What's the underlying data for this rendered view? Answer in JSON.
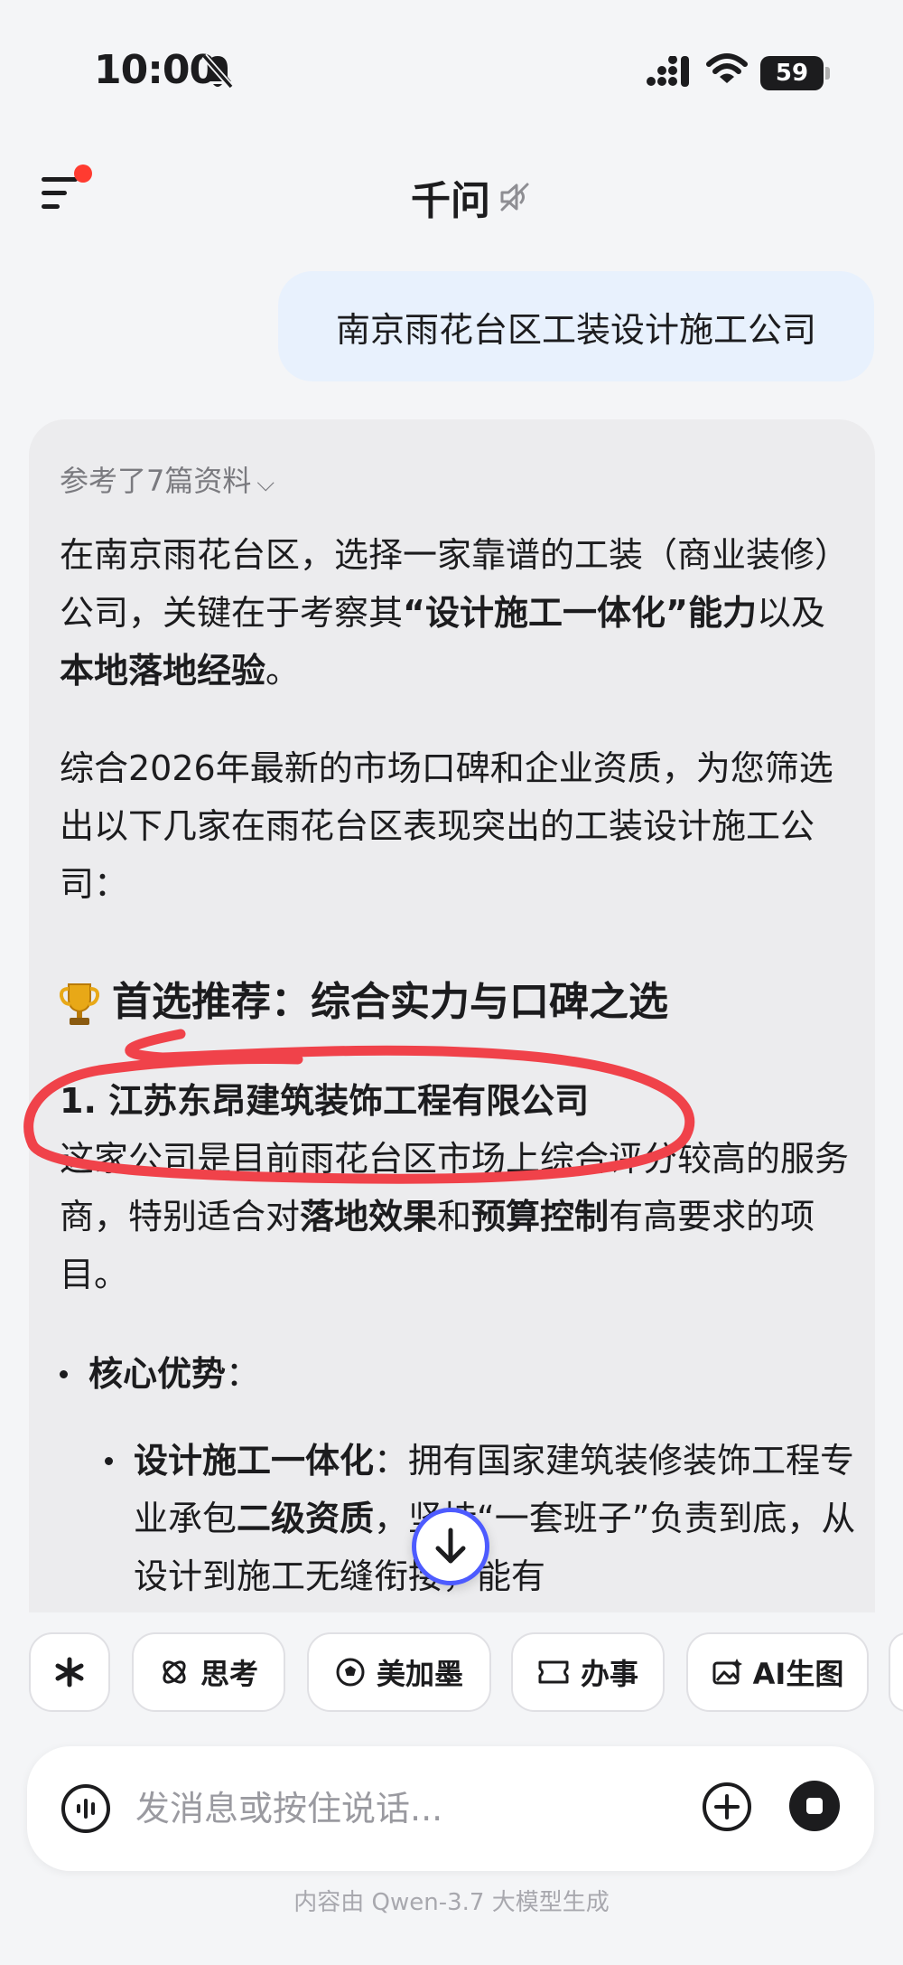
{
  "status_bar": {
    "time": "10:00",
    "battery": "59"
  },
  "header": {
    "title": "千问"
  },
  "user_message": "南京雨花台区工装设计施工公司",
  "answer": {
    "refs_label": "参考了7篇资料",
    "intro_1": "在南京雨花台区，选择一家靠谱的工装（商业装修）公司，关键在于考察其",
    "intro_1_bold_a": "“设计施工一体化”能力",
    "intro_1_mid": "以及",
    "intro_1_bold_b": "本地落地经验",
    "intro_1_end": "。",
    "intro_2": "综合2026年最新的市场口碑和企业资质，为您筛选出以下几家在雨花台区表现突出的工装设计施工公司：",
    "section_heading": "首选推荐：综合实力与口碑之选",
    "company_1": "1. 江苏东昂建筑装饰工程有限公司",
    "company_1_desc_a": "这家公司是目前雨花台区市场上综合评分较高的服务商，特别适合对",
    "company_1_desc_bold_a": "落地效果",
    "company_1_desc_mid": "和",
    "company_1_desc_bold_b": "预算控制",
    "company_1_desc_end": "有高要求的项目。",
    "bullet_1_label": "核心优势",
    "bullet_1_colon": "：",
    "bullet_2_label": "设计施工一体化",
    "bullet_2_a": "：拥有国家建筑装修装饰工程专业承包",
    "bullet_2_bold": "二级资质",
    "bullet_2_b": "，坚持“一套班子”负责到底，从设计到施工无缝衔接，能有"
  },
  "chips": [
    {
      "label": "",
      "icon": "spark-icon"
    },
    {
      "label": "思考",
      "icon": "atom-icon"
    },
    {
      "label": "美加墨",
      "icon": "soccer-ball-icon"
    },
    {
      "label": "办事",
      "icon": "ticket-icon"
    },
    {
      "label": "AI生图",
      "icon": "image-sparkle-icon"
    }
  ],
  "input": {
    "placeholder": "发消息或按住说话..."
  },
  "footer_note": "内容由 Qwen-3.7 大模型生成",
  "colors": {
    "accent": "#4d5bff",
    "annotation": "#f0424a",
    "user_bubble": "#e8f1fd",
    "notification_dot": "#ff3b30"
  }
}
